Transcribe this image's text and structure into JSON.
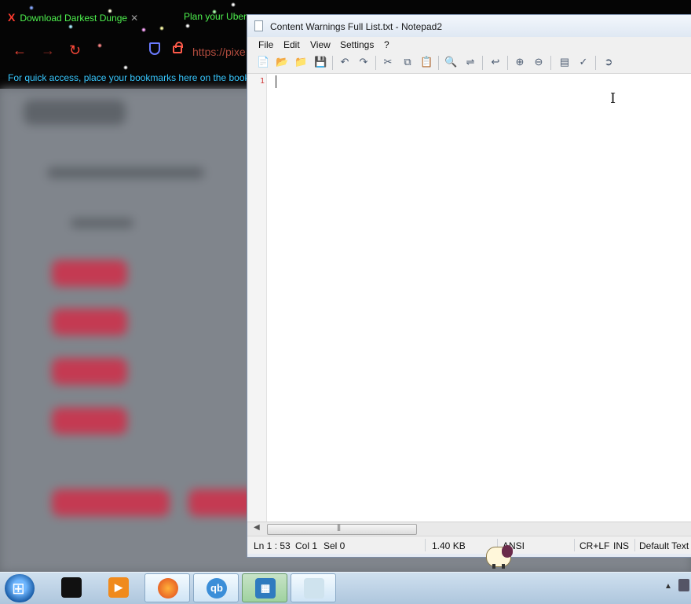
{
  "browser": {
    "tabs": [
      {
        "label": "Download Darkest Dunge",
        "close_glyph": "✕"
      },
      {
        "label": "Plan your Uber"
      }
    ],
    "url": "https://pixe",
    "bookmarks_hint": "For quick access, place your bookmarks here on the book",
    "colors": {
      "tab_text": "#4ef24e",
      "accent": "#ff4a3a",
      "bookmarks_text": "#37c8ff"
    }
  },
  "notepad": {
    "title": "Content Warnings Full List.txt - Notepad2",
    "menu": [
      "File",
      "Edit",
      "View",
      "Settings",
      "?"
    ],
    "toolbar_icons": [
      "new-file-icon",
      "open-file-icon",
      "browse-icon",
      "save-icon",
      "undo-icon",
      "redo-icon",
      "cut-icon",
      "copy-icon",
      "paste-icon",
      "find-icon",
      "replace-icon",
      "word-wrap-icon",
      "zoom-in-icon",
      "zoom-out-icon",
      "scheme-icon",
      "customize-icon",
      "exit-icon"
    ],
    "line_number": "1",
    "status": {
      "position": "Ln 1 : 53",
      "column": "Col 1",
      "selection": "Sel 0",
      "size": "1.40 KB",
      "encoding": "ANSI",
      "line_endings": "CR+LF",
      "mode": "INS",
      "scheme": "Default Text"
    }
  },
  "taskbar": {
    "apps": [
      {
        "name": "start-button"
      },
      {
        "name": "app-icon-1"
      },
      {
        "name": "media-player"
      },
      {
        "name": "firefox"
      },
      {
        "name": "qbittorrent",
        "label": "qb"
      },
      {
        "name": "remote-app"
      },
      {
        "name": "notepad2"
      }
    ],
    "tray_arrow": "▲"
  }
}
